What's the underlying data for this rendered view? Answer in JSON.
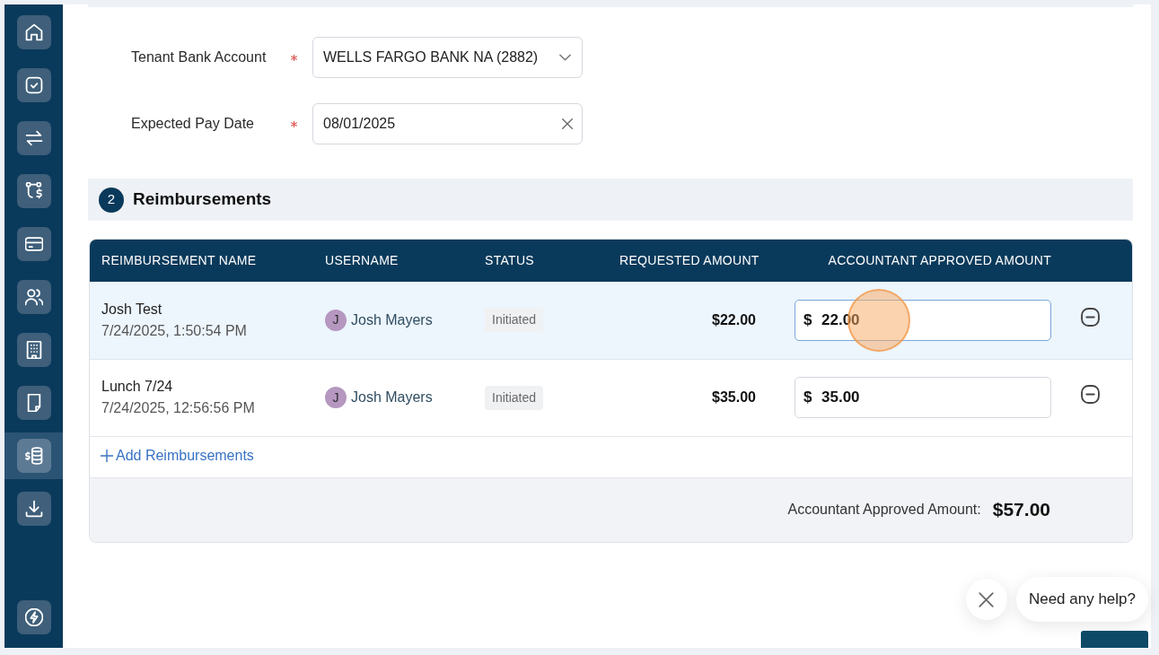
{
  "sidebar": {
    "items": [
      {
        "selected": false
      },
      {
        "selected": false
      },
      {
        "selected": false
      },
      {
        "selected": false
      },
      {
        "selected": false
      },
      {
        "selected": false
      },
      {
        "selected": false
      },
      {
        "selected": false
      },
      {
        "selected": true
      },
      {
        "selected": false
      }
    ],
    "bottom_items": [
      {
        "selected": false
      }
    ]
  },
  "form": {
    "fields": [
      {
        "label": "Tenant Bank Account",
        "required": true,
        "kind": "select",
        "value": "WELLS FARGO BANK NA (2882)"
      },
      {
        "label": "Expected Pay Date",
        "required": true,
        "kind": "date",
        "value": "08/01/2025"
      }
    ]
  },
  "section": {
    "number": "2",
    "title": "Reimbursements"
  },
  "table": {
    "columns": [
      "REIMBURSEMENT NAME",
      "USERNAME",
      "STATUS",
      "REQUESTED AMOUNT",
      "ACCOUNTANT APPROVED AMOUNT"
    ],
    "rows": [
      {
        "name": "Josh Test",
        "date": "7/24/2025, 1:50:54 PM",
        "user_initial": "J",
        "username": "Josh Mayers",
        "status": "Initiated",
        "requested_amount": "$22.00",
        "currency": "$",
        "approved_amount": "22.00",
        "selected": true,
        "click_marker": true
      },
      {
        "name": "Lunch 7/24",
        "date": "7/24/2025, 12:56:56 PM",
        "user_initial": "J",
        "username": "Josh Mayers",
        "status": "Initiated",
        "requested_amount": "$35.00",
        "currency": "$",
        "approved_amount": "35.00",
        "selected": false,
        "click_marker": false
      }
    ],
    "add_link": "Add Reimbursements",
    "total": {
      "label": "Accountant Approved Amount:",
      "value": "$57.00"
    }
  },
  "help_widget": {
    "message": "Need any help?"
  }
}
